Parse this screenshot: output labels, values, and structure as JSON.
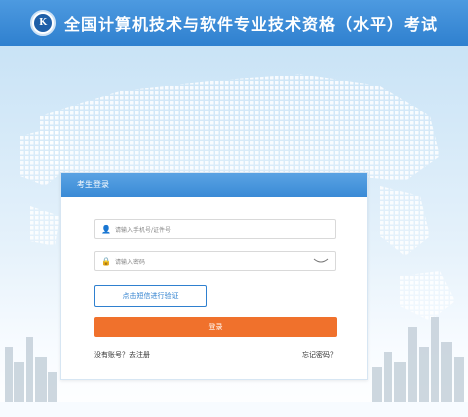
{
  "header": {
    "logo_text": "K",
    "title": "全国计算机技术与软件专业技术资格（水平）考试"
  },
  "login": {
    "title": "考生登录",
    "username_placeholder": "请输入手机号/证件号",
    "password_placeholder": "请输入密码",
    "sms_button": "点击短信进行验证",
    "submit_button": "登录",
    "register_link": "没有账号？去注册",
    "forgot_link": "忘记密码？"
  },
  "colors": {
    "header": "#3a89d6",
    "accent_blue": "#2f80cf",
    "login_orange": "#f0712c"
  },
  "icons": [
    "user-icon",
    "lock-icon",
    "eye-hidden-icon"
  ]
}
